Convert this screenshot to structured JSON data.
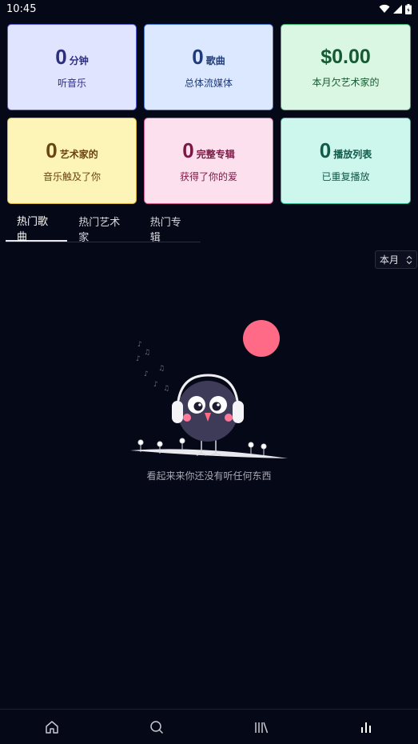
{
  "status_bar": {
    "time": "10:45"
  },
  "stats": [
    {
      "value": "0",
      "unit": "分钟",
      "label": "听音乐"
    },
    {
      "value": "0",
      "unit": "歌曲",
      "label": "总体流媒体"
    },
    {
      "value": "$0.00",
      "unit": "",
      "label": "本月欠艺术家的"
    },
    {
      "value": "0",
      "unit": "艺术家的",
      "label": "音乐触及了你"
    },
    {
      "value": "0",
      "unit": "完整专辑",
      "label": "获得了你的爱"
    },
    {
      "value": "0",
      "unit": "播放列表",
      "label": "已重复播放"
    }
  ],
  "tabs": [
    {
      "label": "热门歌曲",
      "active": true
    },
    {
      "label": "热门艺术家",
      "active": false
    },
    {
      "label": "热门专辑",
      "active": false
    }
  ],
  "period_select": {
    "value": "本月"
  },
  "empty_state": {
    "message": "看起来来你还没有听任何东西"
  },
  "bottom_nav": [
    {
      "icon": "home-icon"
    },
    {
      "icon": "search-icon"
    },
    {
      "icon": "library-icon"
    },
    {
      "icon": "stats-icon",
      "active": true
    }
  ]
}
